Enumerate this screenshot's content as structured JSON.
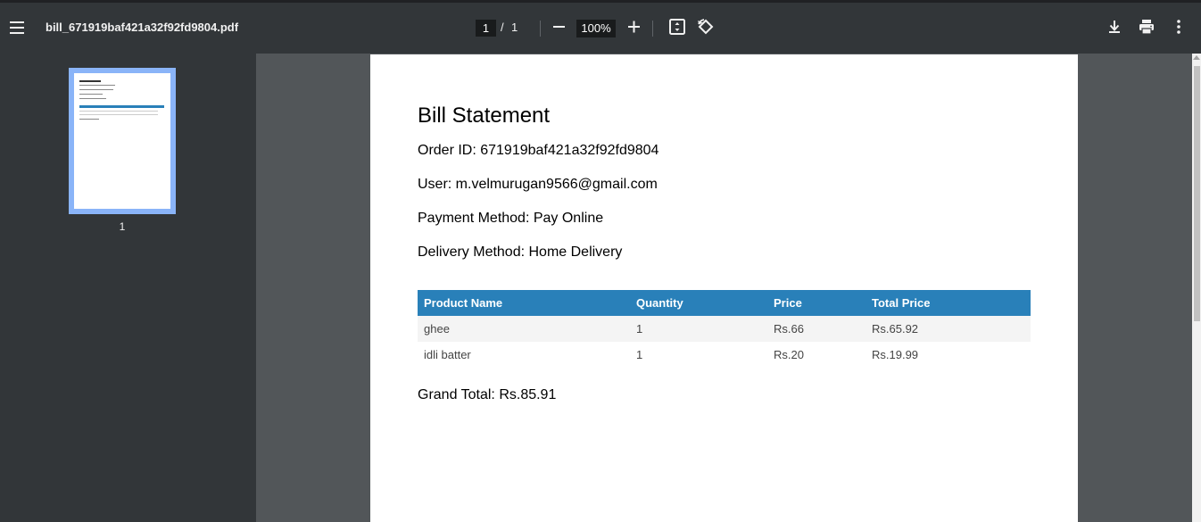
{
  "toolbar": {
    "file_name": "bill_671919baf421a32f92fd9804.pdf",
    "current_page": "1",
    "page_separator": "/",
    "total_pages": "1",
    "zoom": "100%",
    "icons": {
      "menu": "menu-icon",
      "zoom_out": "minus-icon",
      "zoom_in": "plus-icon",
      "fit": "fit-to-page-icon",
      "rotate": "rotate-icon",
      "download": "download-icon",
      "print": "print-icon",
      "more": "more-vert-icon"
    }
  },
  "sidebar": {
    "thumbnail_page_number": "1"
  },
  "document": {
    "title": "Bill Statement",
    "order_id": "Order ID: 671919baf421a32f92fd9804",
    "user": "User: m.velmurugan9566@gmail.com",
    "payment_method": "Payment Method: Pay Online",
    "delivery_method": "Delivery Method: Home Delivery",
    "table": {
      "headers": [
        "Product Name",
        "Quantity",
        "Price",
        "Total Price"
      ],
      "rows": [
        [
          "ghee",
          "1",
          "Rs.66",
          "Rs.65.92"
        ],
        [
          "idli batter",
          "1",
          "Rs.20",
          "Rs.19.99"
        ]
      ]
    },
    "grand_total": "Grand Total: Rs.85.91"
  },
  "colors": {
    "toolbar_bg": "#323639",
    "viewer_bg": "#525659",
    "table_header": "#2980b9",
    "thumb_highlight": "#8ab4f8"
  }
}
